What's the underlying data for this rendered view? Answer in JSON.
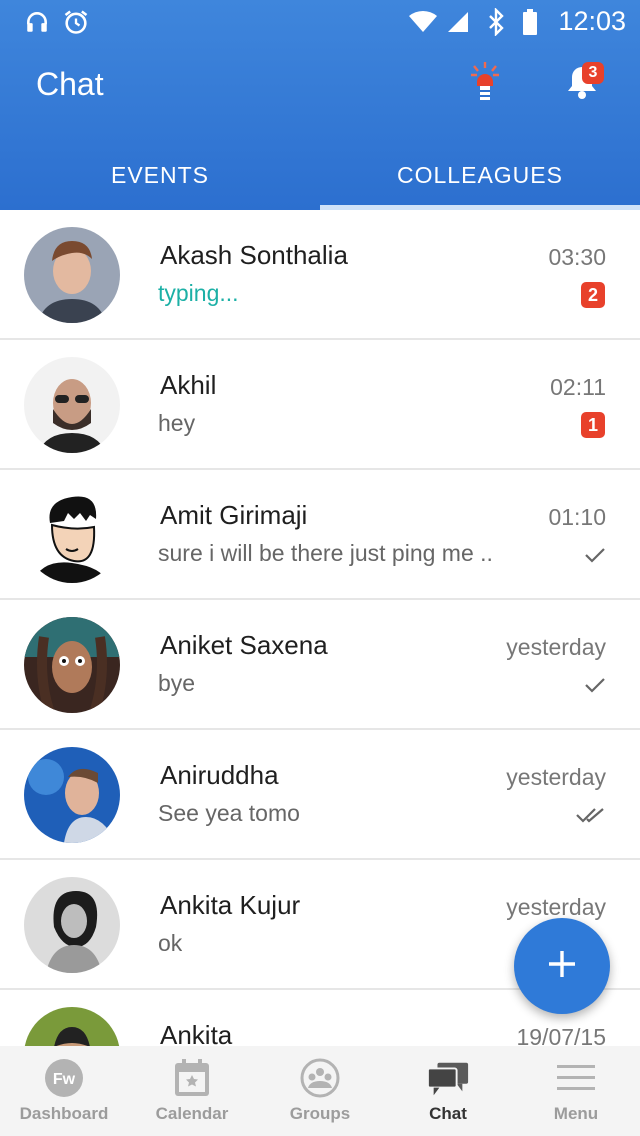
{
  "status_bar": {
    "time": "12:03"
  },
  "app_bar": {
    "title": "Chat",
    "notification_count": "3"
  },
  "tabs": [
    {
      "label": "EVENTS",
      "active": false
    },
    {
      "label": "COLLEAGUES",
      "active": true
    }
  ],
  "chats": [
    {
      "name": "Akash Sonthalia",
      "preview": "typing...",
      "time": "03:30",
      "unread": "2",
      "status": "typing"
    },
    {
      "name": "Akhil",
      "preview": "hey",
      "time": "02:11",
      "unread": "1",
      "status": "unread"
    },
    {
      "name": "Amit Girimaji",
      "preview": "sure i will be there just ping me ..",
      "time": "01:10",
      "status": "sent"
    },
    {
      "name": "Aniket Saxena",
      "preview": "bye",
      "time": "yesterday",
      "status": "sent"
    },
    {
      "name": "Aniruddha",
      "preview": "See yea tomo",
      "time": "yesterday",
      "status": "delivered"
    },
    {
      "name": "Ankita Kujur",
      "preview": "ok",
      "time": "yesterday",
      "status": "sent"
    },
    {
      "name": "Ankita",
      "preview": "",
      "time": "19/07/15",
      "status": ""
    }
  ],
  "bottom_nav": [
    {
      "label": "Dashboard",
      "icon": "fw-logo-icon"
    },
    {
      "label": "Calendar",
      "icon": "calendar-icon"
    },
    {
      "label": "Groups",
      "icon": "groups-icon"
    },
    {
      "label": "Chat",
      "icon": "chat-icon",
      "active": true
    },
    {
      "label": "Menu",
      "icon": "menu-icon"
    }
  ],
  "colors": {
    "primary": "#2c6fcf",
    "badge": "#e8412b",
    "typing": "#1cb0a6",
    "fab": "#2f7ad8"
  }
}
